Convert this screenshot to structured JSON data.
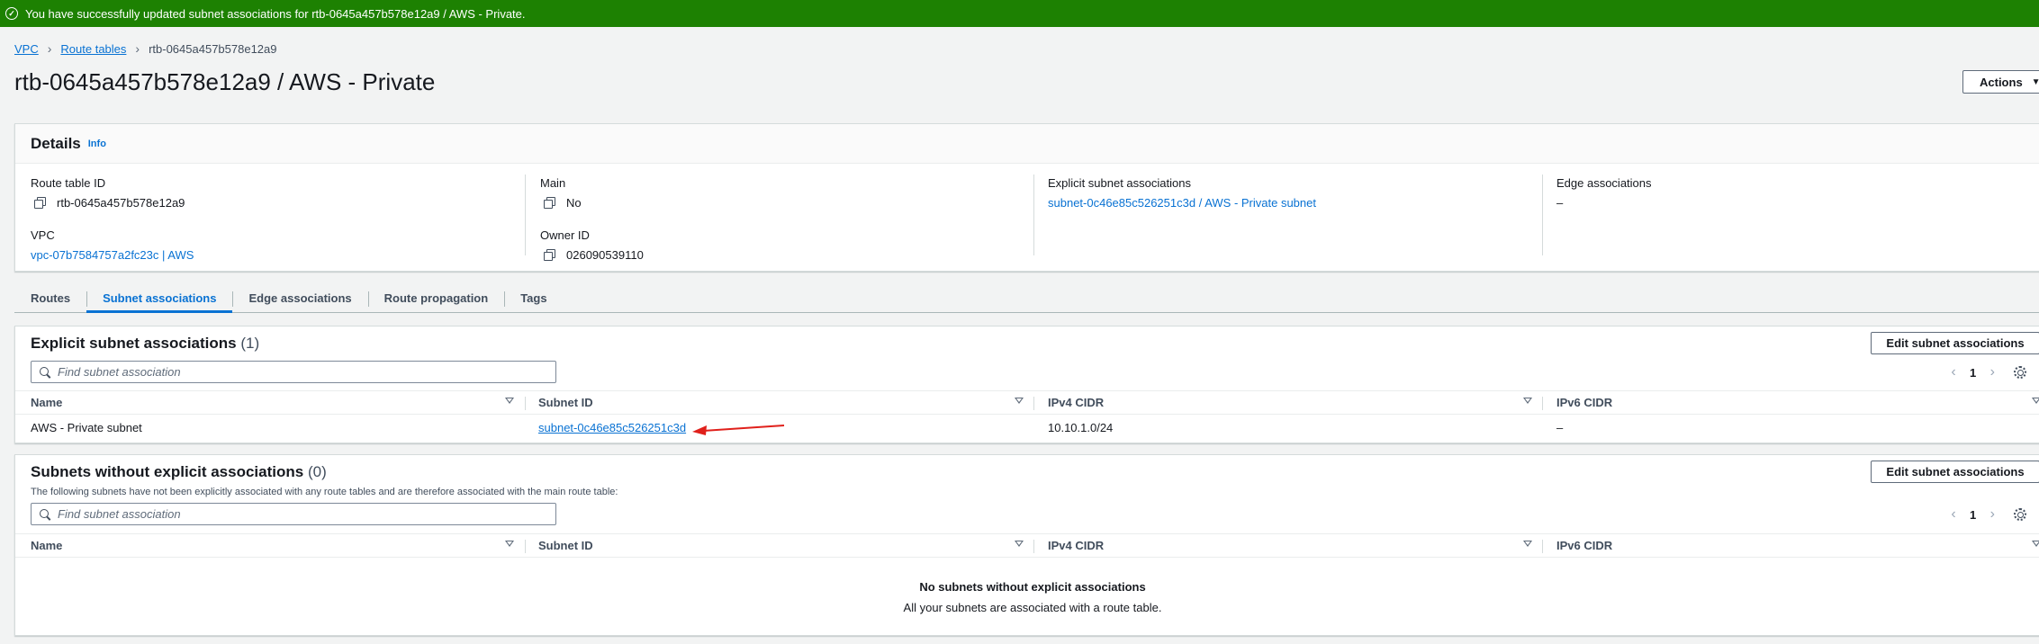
{
  "flash": {
    "icon": "check-circle-icon",
    "message": "You have successfully updated subnet associations for rtb-0645a457b578e12a9 / AWS - Private.",
    "color": "#1d8102"
  },
  "breadcrumb": {
    "items": [
      "VPC",
      "Route tables"
    ],
    "current": "rtb-0645a457b578e12a9"
  },
  "page": {
    "title": "rtb-0645a457b578e12a9 / AWS - Private",
    "actions_label": "Actions"
  },
  "details": {
    "title": "Details",
    "info": "Info",
    "route_table_id_label": "Route table ID",
    "route_table_id": "rtb-0645a457b578e12a9",
    "vpc_label": "VPC",
    "vpc": "vpc-07b7584757a2fc23c | AWS",
    "main_label": "Main",
    "main": "No",
    "owner_label": "Owner ID",
    "owner": "026090539110",
    "explicit_label": "Explicit subnet associations",
    "explicit": "subnet-0c46e85c526251c3d / AWS - Private subnet",
    "edge_label": "Edge associations",
    "edge": "–"
  },
  "tabs": [
    {
      "label": "Routes"
    },
    {
      "label": "Subnet associations",
      "active": true
    },
    {
      "label": "Edge associations"
    },
    {
      "label": "Route propagation"
    },
    {
      "label": "Tags"
    }
  ],
  "explicit_section": {
    "title": "Explicit subnet associations",
    "count": "(1)",
    "edit_label": "Edit subnet associations",
    "search_placeholder": "Find subnet association",
    "page": "1",
    "columns": [
      "Name",
      "Subnet ID",
      "IPv4 CIDR",
      "IPv6 CIDR"
    ],
    "rows": [
      {
        "name": "AWS - Private subnet",
        "subnet_id": "subnet-0c46e85c526251c3d",
        "ipv4": "10.10.1.0/24",
        "ipv6": "–"
      }
    ]
  },
  "without_section": {
    "title": "Subnets without explicit associations",
    "count": "(0)",
    "description": "The following subnets have not been explicitly associated with any route tables and are therefore associated with the main route table:",
    "edit_label": "Edit subnet associations",
    "search_placeholder": "Find subnet association",
    "page": "1",
    "columns": [
      "Name",
      "Subnet ID",
      "IPv4 CIDR",
      "IPv6 CIDR"
    ],
    "empty_title": "No subnets without explicit associations",
    "empty_text": "All your subnets are associated with a route table."
  },
  "colors": {
    "link": "#0972d3",
    "success": "#1d8102",
    "annotation_arrow": "#e0201b"
  }
}
